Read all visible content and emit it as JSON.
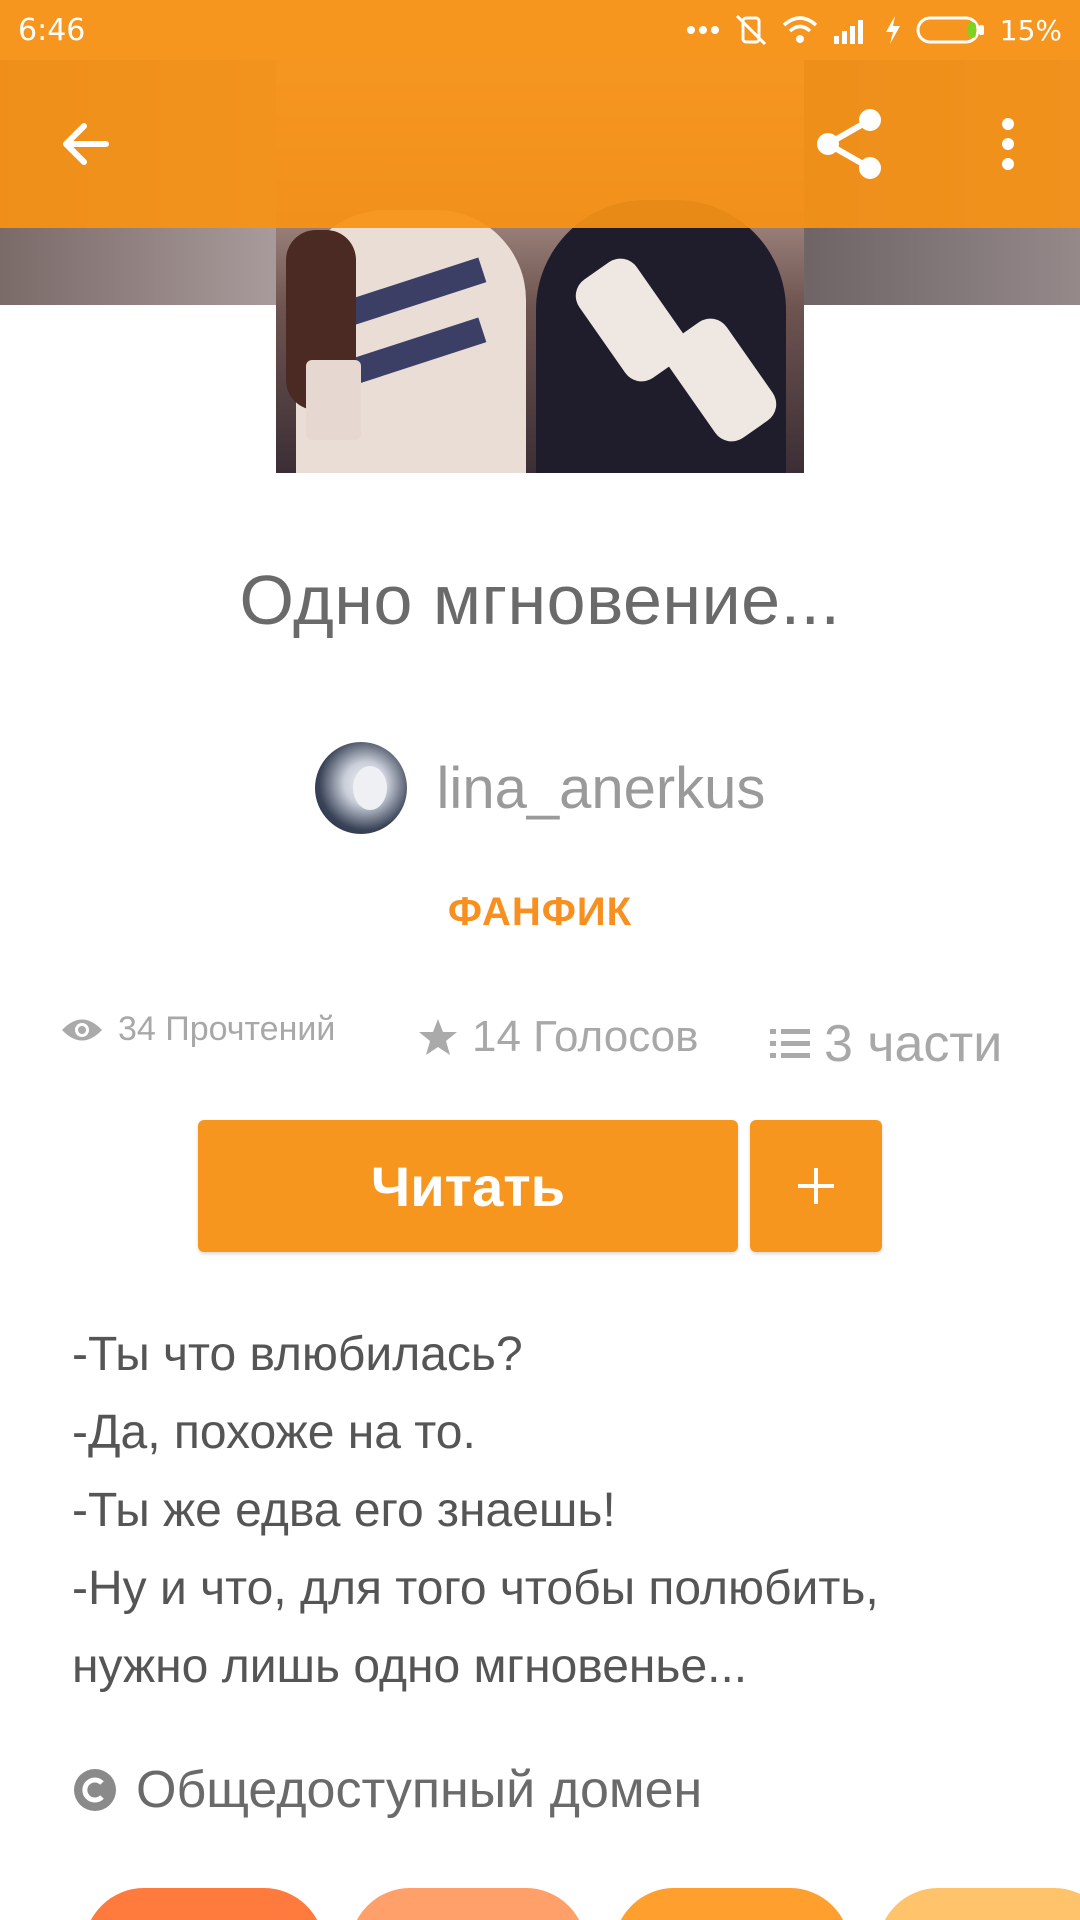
{
  "status_bar": {
    "time": "6:46",
    "battery": "15%"
  },
  "toolbar": {
    "back_icon": "arrow-left-icon",
    "share_icon": "share-icon",
    "more_icon": "more-vertical-icon"
  },
  "story": {
    "title": "Одно мгновение...",
    "author": "lina_anerkus",
    "category": "ФАНФИК",
    "reads": "34 Прочтений",
    "votes": "14 Голосов",
    "parts": "3 части",
    "read_button": "Читать",
    "add_button": "+",
    "description": [
      "-Ты что влюбилась?",
      "-Да, похоже на то.",
      "-Ты же едва его знаешь!",
      "-Ну и что, для того чтобы полюбить,",
      "нужно лишь одно мгновенье..."
    ],
    "license": "Общедоступный домен"
  },
  "colors": {
    "accent": "#f7961e",
    "tag_colors": [
      "#ff7a3d",
      "#ffa06a",
      "#ff9f2e",
      "#ffc46b"
    ]
  }
}
